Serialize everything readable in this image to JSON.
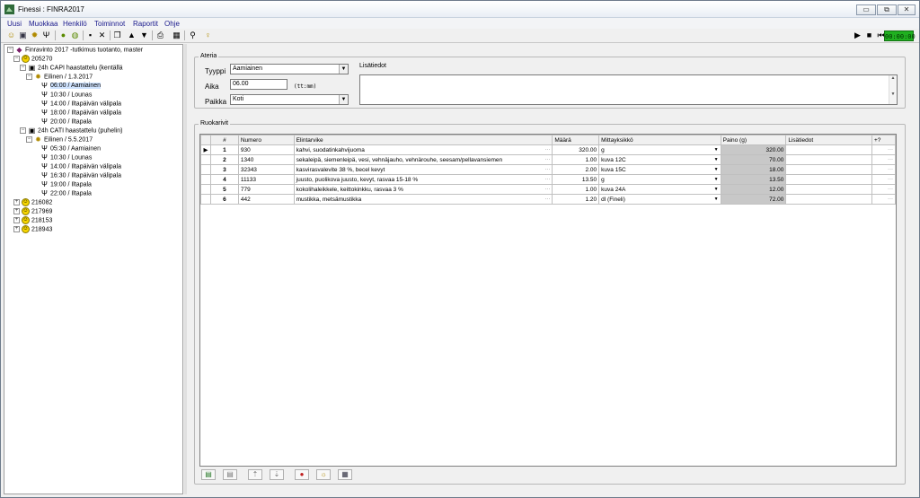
{
  "window": {
    "title": "Finessi : FINRA2017",
    "buttons": {
      "minimize": "▭",
      "maximize": "⧉",
      "close": "✕"
    }
  },
  "menu": [
    "Uusi",
    "Muokkaa",
    "Henkilö",
    "Toiminnot",
    "Raportit",
    "Ohje"
  ],
  "toolbar": {
    "timer": "00:00:00",
    "player": {
      "play": "▶",
      "stop": "■",
      "rewind": "⏮"
    }
  },
  "tree": {
    "root": "Finravinto 2017 -tutkimus tuotanto, master",
    "person_id": "205270",
    "interviews": [
      {
        "label": "24h CAPI haastattelu (kentällä",
        "day": "Eilinen / 1.3.2017",
        "meals": [
          "06:00 / Aamiainen",
          "10:30 / Lounas",
          "14:00 / Iltapäivän välipala",
          "18:00 / Iltapäivän välipala",
          "20:00 / Iltapala"
        ]
      },
      {
        "label": "24h CATI haastattelu (puhelin)",
        "day": "Eilinen / 5.5.2017",
        "meals": [
          "05:30 / Aamiainen",
          "10:30 / Lounas",
          "14:00 / Iltapäivän välipala",
          "16:30 / Iltapäivän välipala",
          "19:00 / Iltapala",
          "22:00 / Iltapala"
        ]
      }
    ],
    "other_persons": [
      "216082",
      "217969",
      "218153",
      "218943"
    ]
  },
  "ateria": {
    "group_title": "Ateria",
    "tyyppi_label": "Tyyppi",
    "tyyppi_value": "Aamiainen",
    "aika_label": "Aika",
    "aika_value": "06.00",
    "aika_hint": "(tt:mm)",
    "paikka_label": "Paikka",
    "paikka_value": "Koti",
    "lisatiedot_label": "Lisätiedot"
  },
  "ruokarivit": {
    "group_title": "Ruokarivit",
    "headers": [
      "#",
      "Numero",
      "Elintarvike",
      "Määrä",
      "Mittayksikkö",
      "Paino (g)",
      "Lisätiedot",
      "+?"
    ],
    "rows": [
      {
        "n": "1",
        "numero": "930",
        "elintarvike": "kahvi, suodatinkahvijuoma",
        "maara": "320.00",
        "mitta": "g",
        "paino": "320.00"
      },
      {
        "n": "2",
        "numero": "1340",
        "elintarvike": "sekaleipä, siemenleipä, vesi, vehnäjauho, vehnärouhe, seesam/pellavansiemen",
        "maara": "1.00",
        "mitta": "kuva 12C",
        "paino": "70.00"
      },
      {
        "n": "3",
        "numero": "32343",
        "elintarvike": "kasvirasvalevite 38 %, becel kevyt",
        "maara": "2.00",
        "mitta": "kuva 15C",
        "paino": "18.00"
      },
      {
        "n": "4",
        "numero": "11133",
        "elintarvike": "juusto, puolikova juusto, kevyt, rasvaa 15-18 %",
        "maara": "13.50",
        "mitta": "g",
        "paino": "13.50"
      },
      {
        "n": "5",
        "numero": "779",
        "elintarvike": "kokolihaleikkele, keittokinkku, rasvaa 3 %",
        "maara": "1.00",
        "mitta": "kuva 24A",
        "paino": "12.00"
      },
      {
        "n": "6",
        "numero": "442",
        "elintarvike": "mustikka, metsämustikka",
        "maara": "1.20",
        "mitta": "dl (Fineli)",
        "paino": "72.00"
      }
    ]
  },
  "colors": {
    "timer_bg": "#20b020",
    "selection": "#cfe3ff",
    "weight_cell": "#c8c8c8"
  }
}
